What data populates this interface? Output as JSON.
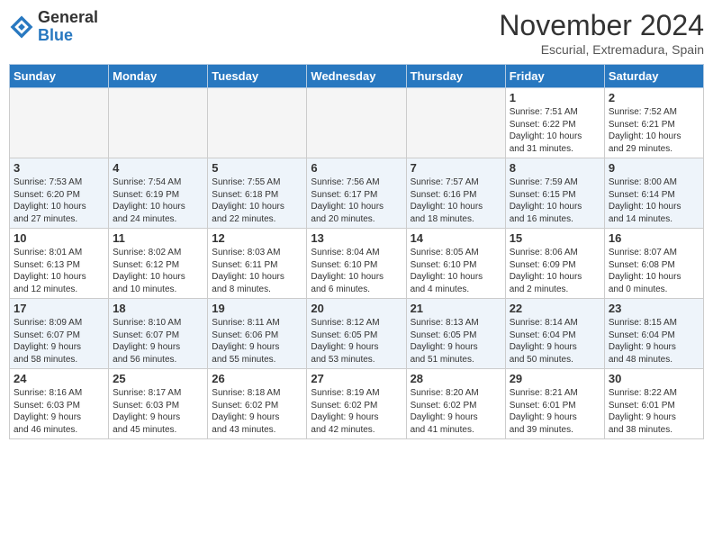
{
  "header": {
    "logo": {
      "general": "General",
      "blue": "Blue"
    },
    "month": "November 2024",
    "location": "Escurial, Extremadura, Spain"
  },
  "weekdays": [
    "Sunday",
    "Monday",
    "Tuesday",
    "Wednesday",
    "Thursday",
    "Friday",
    "Saturday"
  ],
  "weeks": [
    [
      {
        "day": "",
        "info": ""
      },
      {
        "day": "",
        "info": ""
      },
      {
        "day": "",
        "info": ""
      },
      {
        "day": "",
        "info": ""
      },
      {
        "day": "",
        "info": ""
      },
      {
        "day": "1",
        "info": "Sunrise: 7:51 AM\nSunset: 6:22 PM\nDaylight: 10 hours\nand 31 minutes."
      },
      {
        "day": "2",
        "info": "Sunrise: 7:52 AM\nSunset: 6:21 PM\nDaylight: 10 hours\nand 29 minutes."
      }
    ],
    [
      {
        "day": "3",
        "info": "Sunrise: 7:53 AM\nSunset: 6:20 PM\nDaylight: 10 hours\nand 27 minutes."
      },
      {
        "day": "4",
        "info": "Sunrise: 7:54 AM\nSunset: 6:19 PM\nDaylight: 10 hours\nand 24 minutes."
      },
      {
        "day": "5",
        "info": "Sunrise: 7:55 AM\nSunset: 6:18 PM\nDaylight: 10 hours\nand 22 minutes."
      },
      {
        "day": "6",
        "info": "Sunrise: 7:56 AM\nSunset: 6:17 PM\nDaylight: 10 hours\nand 20 minutes."
      },
      {
        "day": "7",
        "info": "Sunrise: 7:57 AM\nSunset: 6:16 PM\nDaylight: 10 hours\nand 18 minutes."
      },
      {
        "day": "8",
        "info": "Sunrise: 7:59 AM\nSunset: 6:15 PM\nDaylight: 10 hours\nand 16 minutes."
      },
      {
        "day": "9",
        "info": "Sunrise: 8:00 AM\nSunset: 6:14 PM\nDaylight: 10 hours\nand 14 minutes."
      }
    ],
    [
      {
        "day": "10",
        "info": "Sunrise: 8:01 AM\nSunset: 6:13 PM\nDaylight: 10 hours\nand 12 minutes."
      },
      {
        "day": "11",
        "info": "Sunrise: 8:02 AM\nSunset: 6:12 PM\nDaylight: 10 hours\nand 10 minutes."
      },
      {
        "day": "12",
        "info": "Sunrise: 8:03 AM\nSunset: 6:11 PM\nDaylight: 10 hours\nand 8 minutes."
      },
      {
        "day": "13",
        "info": "Sunrise: 8:04 AM\nSunset: 6:10 PM\nDaylight: 10 hours\nand 6 minutes."
      },
      {
        "day": "14",
        "info": "Sunrise: 8:05 AM\nSunset: 6:10 PM\nDaylight: 10 hours\nand 4 minutes."
      },
      {
        "day": "15",
        "info": "Sunrise: 8:06 AM\nSunset: 6:09 PM\nDaylight: 10 hours\nand 2 minutes."
      },
      {
        "day": "16",
        "info": "Sunrise: 8:07 AM\nSunset: 6:08 PM\nDaylight: 10 hours\nand 0 minutes."
      }
    ],
    [
      {
        "day": "17",
        "info": "Sunrise: 8:09 AM\nSunset: 6:07 PM\nDaylight: 9 hours\nand 58 minutes."
      },
      {
        "day": "18",
        "info": "Sunrise: 8:10 AM\nSunset: 6:07 PM\nDaylight: 9 hours\nand 56 minutes."
      },
      {
        "day": "19",
        "info": "Sunrise: 8:11 AM\nSunset: 6:06 PM\nDaylight: 9 hours\nand 55 minutes."
      },
      {
        "day": "20",
        "info": "Sunrise: 8:12 AM\nSunset: 6:05 PM\nDaylight: 9 hours\nand 53 minutes."
      },
      {
        "day": "21",
        "info": "Sunrise: 8:13 AM\nSunset: 6:05 PM\nDaylight: 9 hours\nand 51 minutes."
      },
      {
        "day": "22",
        "info": "Sunrise: 8:14 AM\nSunset: 6:04 PM\nDaylight: 9 hours\nand 50 minutes."
      },
      {
        "day": "23",
        "info": "Sunrise: 8:15 AM\nSunset: 6:04 PM\nDaylight: 9 hours\nand 48 minutes."
      }
    ],
    [
      {
        "day": "24",
        "info": "Sunrise: 8:16 AM\nSunset: 6:03 PM\nDaylight: 9 hours\nand 46 minutes."
      },
      {
        "day": "25",
        "info": "Sunrise: 8:17 AM\nSunset: 6:03 PM\nDaylight: 9 hours\nand 45 minutes."
      },
      {
        "day": "26",
        "info": "Sunrise: 8:18 AM\nSunset: 6:02 PM\nDaylight: 9 hours\nand 43 minutes."
      },
      {
        "day": "27",
        "info": "Sunrise: 8:19 AM\nSunset: 6:02 PM\nDaylight: 9 hours\nand 42 minutes."
      },
      {
        "day": "28",
        "info": "Sunrise: 8:20 AM\nSunset: 6:02 PM\nDaylight: 9 hours\nand 41 minutes."
      },
      {
        "day": "29",
        "info": "Sunrise: 8:21 AM\nSunset: 6:01 PM\nDaylight: 9 hours\nand 39 minutes."
      },
      {
        "day": "30",
        "info": "Sunrise: 8:22 AM\nSunset: 6:01 PM\nDaylight: 9 hours\nand 38 minutes."
      }
    ]
  ]
}
